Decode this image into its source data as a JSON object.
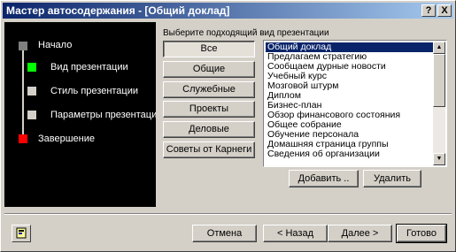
{
  "window": {
    "title": "Мастер автосодержания - [Общий доклад]",
    "help_glyph": "?",
    "close_glyph": "X"
  },
  "steps": [
    {
      "label": "Начало",
      "state": "done",
      "color": "#808080"
    },
    {
      "label": "Вид презентации",
      "state": "current",
      "color": "#00ff00"
    },
    {
      "label": "Стиль презентации",
      "state": "pending",
      "color": "#d4d0c8"
    },
    {
      "label": "Параметры презентации",
      "state": "pending",
      "color": "#d4d0c8"
    },
    {
      "label": "Завершение",
      "state": "pending",
      "color": "#ff0000"
    }
  ],
  "content": {
    "group_label": "Выберите подходящий вид презентации",
    "categories": [
      "Все",
      "Общие",
      "Служебные",
      "Проекты",
      "Деловые",
      "Советы от Карнеги"
    ],
    "selected_category": "Все",
    "templates": [
      "Общий доклад",
      "Предлагаем стратегию",
      "Сообщаем дурные новости",
      "Учебный курс",
      "Мозговой штурм",
      "Диплом",
      "Бизнес-план",
      "Обзор финансового состояния",
      "Общее собрание",
      "Обучение персонала",
      "Домашняя страница группы",
      "Сведения об организации"
    ],
    "selected_template": "Общий доклад",
    "add_button": "Добавить ..",
    "remove_button": "Удалить"
  },
  "footer": {
    "cancel": "Отмена",
    "back": "< Назад",
    "next": "Далее >",
    "finish": "Готово"
  },
  "icons": {
    "help": "office-assistant-icon",
    "scroll_up": "▲",
    "scroll_down": "▼"
  }
}
